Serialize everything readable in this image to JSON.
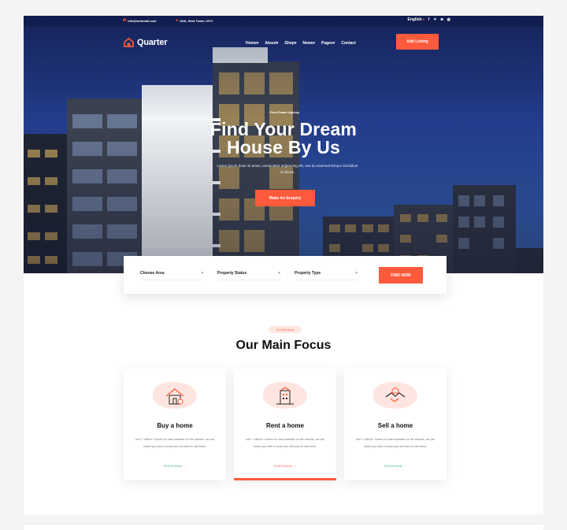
{
  "topbar": {
    "email": "info@webmail.com",
    "address": "15/A, Nest Tower, NYC",
    "language": "English",
    "social": [
      "facebook-icon",
      "twitter-icon",
      "instagram-icon",
      "dribbble-icon"
    ]
  },
  "nav": {
    "logo": "Quarter",
    "items": [
      "Home",
      "About",
      "Shop",
      "News",
      "Pages",
      "Contact"
    ],
    "cta": "Add Listing"
  },
  "hero": {
    "badge": "Real Estate Agency",
    "headline_line1": "Find Your Dream",
    "headline_line2": "House By Us",
    "subtitle": "Lorem ipsum dolor sit amet, consectetur adipisicing elit, sed do eiusmod tempor incididunt ut labore.",
    "button": "Make An Enquiry"
  },
  "search": {
    "area": "Choose Area",
    "status": "Property Status",
    "type": "Property Type",
    "button": "FIND NOW"
  },
  "services": {
    "pill": "Our Services",
    "title": "Our Main Focus",
    "cards": [
      {
        "title": "Buy a home",
        "desc": "over 1 million+ homes for sale available on the website, we can match you with a house you will want to call home.",
        "link": "Find A Home →",
        "icon": "house-icon"
      },
      {
        "title": "Rent a home",
        "desc": "over 1 million+ homes for sale available on the website, we can match you with a house you will want to call home.",
        "link": "Find A Home →",
        "icon": "building-icon"
      },
      {
        "title": "Sell a home",
        "desc": "over 1 million+ homes for sale available on the website, we can match you with a house you will want to call home.",
        "link": "Find A Home →",
        "icon": "handshake-icon"
      }
    ]
  },
  "colors": {
    "accent": "#ff5a3c",
    "link_teal": "#41a79a",
    "hero_sky": "#243f8f"
  }
}
